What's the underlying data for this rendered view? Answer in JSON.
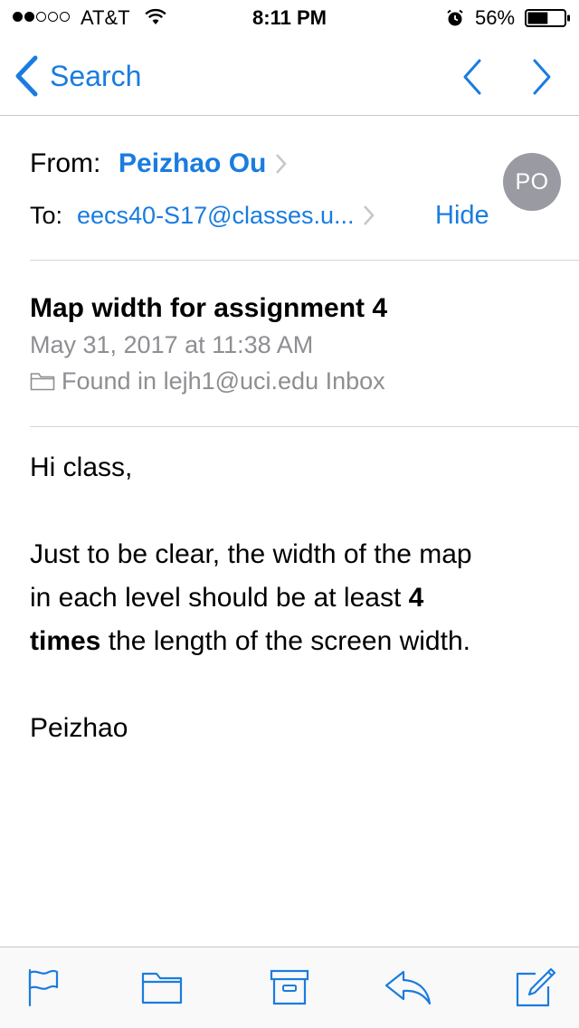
{
  "status_bar": {
    "carrier": "AT&T",
    "time": "8:11 PM",
    "battery_percent": "56%",
    "battery_level": 0.56,
    "signal_bars_filled": 2,
    "signal_bars_total": 5
  },
  "nav": {
    "back_label": "Search",
    "icons": [
      "chevron-left-icon",
      "previous-message-icon",
      "next-message-icon"
    ]
  },
  "header": {
    "from_label": "From:",
    "from_name": "Peizhao Ou",
    "to_label": "To:",
    "to_address": "eecs40-S17@classes.u...",
    "hide_label": "Hide",
    "avatar_initials": "PO"
  },
  "message": {
    "subject": "Map width for assignment 4",
    "date": "May 31, 2017 at 11:38 AM",
    "location": "Found in lejh1@uci.edu Inbox",
    "greeting": "Hi class,",
    "line1": "Just to be clear, the width of the map",
    "line2_a": "in each level should be at least ",
    "line2_b": "4",
    "line3_a": "times",
    "line3_b": " the length of the screen width.",
    "signature": "Peizhao"
  },
  "toolbar": {
    "icons": [
      "flag-icon",
      "folder-icon",
      "archive-icon",
      "reply-icon",
      "compose-icon"
    ]
  },
  "colors": {
    "accent": "#1a7ce0",
    "secondary_text": "#8e8e93",
    "avatar_bg": "#9a9ba2"
  }
}
